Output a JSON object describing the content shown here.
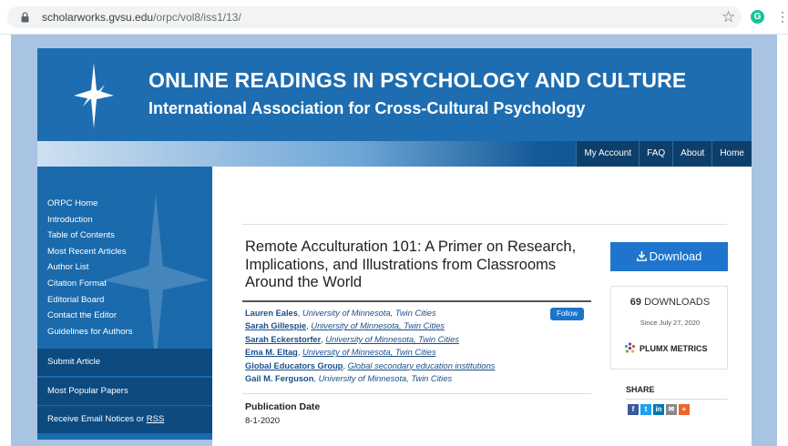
{
  "browser": {
    "url_host": "scholarworks.gvsu.edu",
    "url_path": "/orpc/vol8/iss1/13/"
  },
  "banner": {
    "title": "ONLINE READINGS IN PSYCHOLOGY AND CULTURE",
    "subtitle": "International Association for Cross-Cultural Psychology"
  },
  "topnav": [
    "My Account",
    "FAQ",
    "About",
    "Home"
  ],
  "sidebar": {
    "links": [
      "ORPC Home",
      "Introduction",
      "Table of Contents",
      "Most Recent Articles",
      "Author List",
      "Citation Format",
      "Editorial Board",
      "Contact the Editor",
      "Guidelines for Authors"
    ],
    "submit": "Submit Article",
    "popular": "Most Popular Papers",
    "notices": "Receive Email Notices or ",
    "rss": "RSS"
  },
  "article": {
    "title": "Remote Acculturation 101: A Primer on Research, Implications, and Illustrations from Classrooms Around the World",
    "follow_label": "Follow",
    "authors": [
      {
        "name": "Lauren Eales",
        "affiliation": "University of Minnesota, Twin Cities"
      },
      {
        "name": "Sarah Gillespie",
        "affiliation": "University of Minnesota, Twin Cities"
      },
      {
        "name": "Sarah Eckerstorfer",
        "affiliation": "University of Minnesota, Twin Cities"
      },
      {
        "name": "Ema M. Eltag",
        "affiliation": "University of Minnesota, Twin Cities"
      },
      {
        "name": "Global Educators Group",
        "affiliation": "Global secondary education institutions"
      },
      {
        "name": "Gail M. Ferguson",
        "affiliation": "University of Minnesota, Twin Cities"
      }
    ],
    "pub_date_label": "Publication Date",
    "pub_date": "8-1-2020"
  },
  "sidepanel": {
    "download_label": "Download",
    "downloads_count": "69",
    "downloads_word": "DOWNLOADS",
    "since": "Since July 27, 2020",
    "plumx": "PLUMX METRICS",
    "share_label": "SHARE"
  },
  "colors": {
    "banner": "#1e6db0",
    "nav_dark": "#0e3f6b",
    "accent": "#1f75cd"
  }
}
